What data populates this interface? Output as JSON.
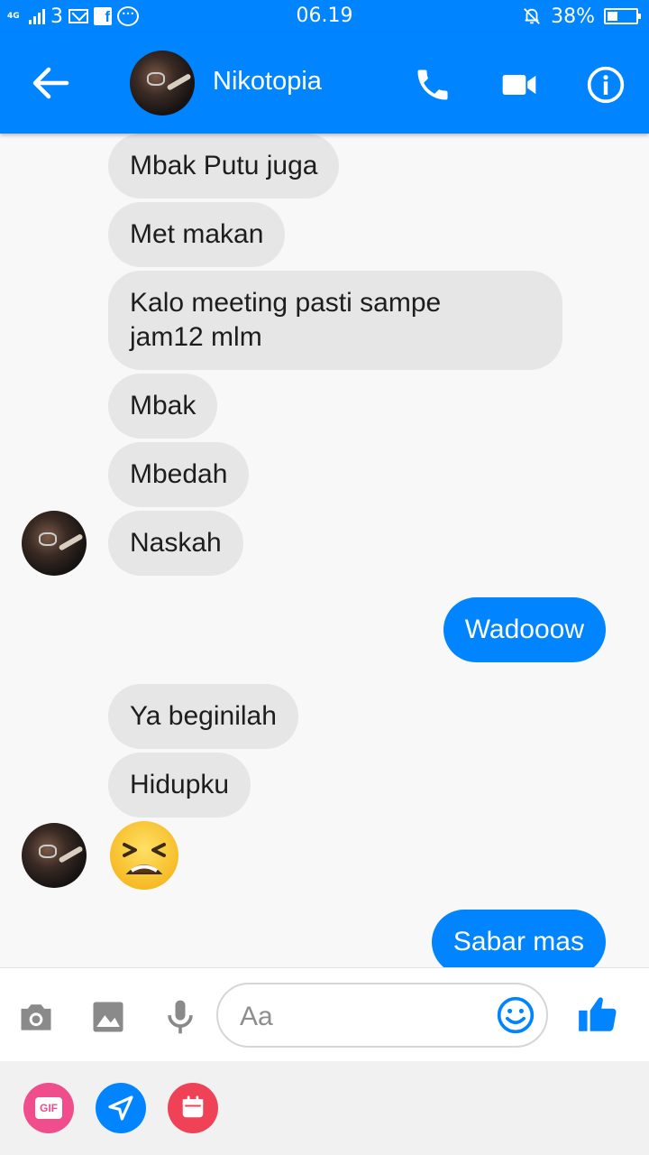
{
  "status_bar": {
    "network": "4G",
    "notification_count": "3",
    "time": "06.19",
    "battery": "38%",
    "battery_level": 0.38
  },
  "header": {
    "contact_name": "Nikotopia",
    "icons": [
      "back-arrow-icon",
      "phone-icon",
      "video-camera-icon",
      "info-icon"
    ]
  },
  "messages": [
    {
      "from": "them",
      "text": "Mbak Putu juga"
    },
    {
      "from": "them",
      "text": "Met makan"
    },
    {
      "from": "them",
      "text": "Kalo meeting pasti sampe",
      "text2": "jam12 mlm"
    },
    {
      "from": "them",
      "text": "Mbak"
    },
    {
      "from": "them",
      "text": "Mbedah"
    },
    {
      "from": "them",
      "text": "Naskah"
    },
    {
      "from": "me",
      "text": "Wadooow"
    },
    {
      "from": "them",
      "text": "Ya beginilah"
    },
    {
      "from": "them",
      "text": "Hidupku"
    },
    {
      "from": "them",
      "emoji": "tired-face-emoji"
    },
    {
      "from": "me",
      "text": "Sabar mas"
    }
  ],
  "composer": {
    "placeholder": "Aa",
    "icons": [
      "camera-icon",
      "image-icon",
      "microphone-icon",
      "smiley-icon",
      "thumbs-up-icon"
    ]
  },
  "tray": {
    "gif_label": "GIF",
    "icons": [
      "gif-icon",
      "location-icon",
      "calendar-icon"
    ]
  },
  "colors": {
    "accent": "#0084ff",
    "incoming_bubble": "#e6e6e6",
    "gif_button": "#ef4d8c",
    "calendar_button": "#f04256"
  }
}
